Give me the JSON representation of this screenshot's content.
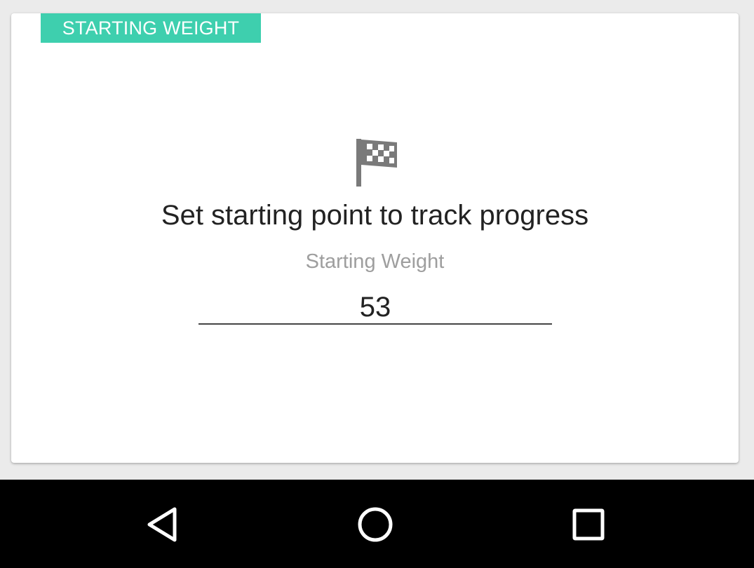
{
  "card": {
    "badge": "STARTING WEIGHT",
    "icon": "checkered-flag-icon",
    "headline": "Set starting point to track progress",
    "field_label": "Starting Weight",
    "weight_value": "53"
  },
  "nav": {
    "back_icon": "back-triangle-icon",
    "home_icon": "home-circle-icon",
    "recents_icon": "recents-square-icon"
  },
  "colors": {
    "accent": "#3ecfae",
    "background": "#ebebeb",
    "card": "#ffffff",
    "navbar": "#000000",
    "icon_gray": "#7a7a7a"
  }
}
